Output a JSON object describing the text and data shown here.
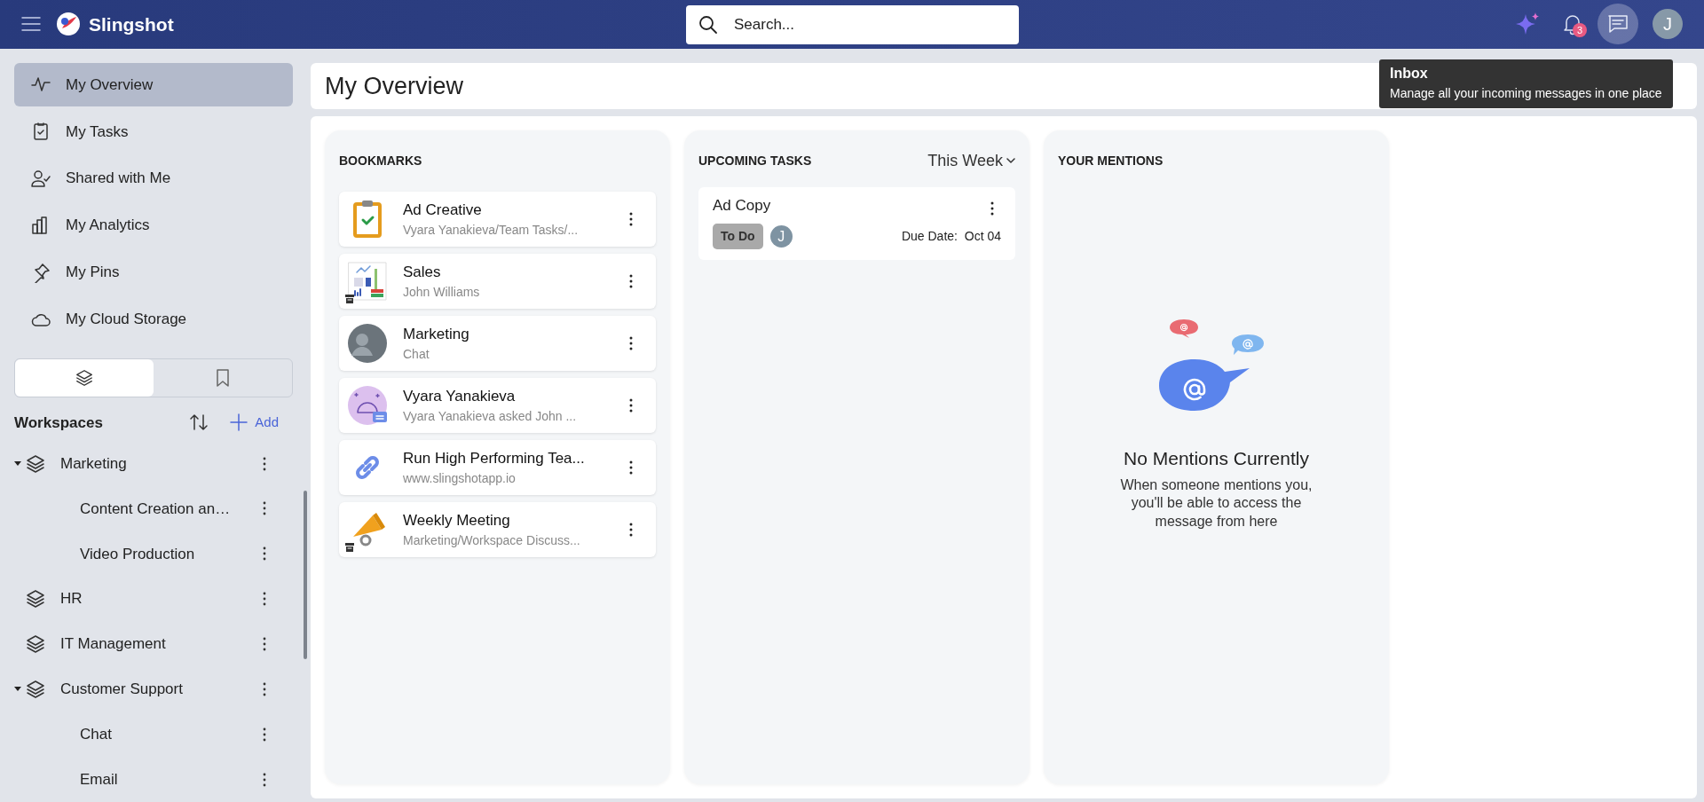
{
  "header": {
    "app_name": "Slingshot",
    "search": {
      "placeholder": "Search..."
    },
    "notification_count": "3",
    "inbox_hovered": true,
    "avatar_letter": "J"
  },
  "tooltip": {
    "title": "Inbox",
    "text": "Manage all your incoming messages in one place"
  },
  "sidebar": {
    "items": [
      {
        "label": "My Overview",
        "kind": "pulse",
        "selected": true
      },
      {
        "label": "My Tasks",
        "kind": "tasks",
        "selected": false
      },
      {
        "label": "Shared with Me",
        "kind": "shared",
        "selected": false
      },
      {
        "label": "My Analytics",
        "kind": "analytics",
        "selected": false
      },
      {
        "label": "My Pins",
        "kind": "pin",
        "selected": false
      },
      {
        "label": "My Cloud Storage",
        "kind": "cloud",
        "selected": false
      }
    ],
    "tabs": [
      {
        "kind": "layers",
        "selected": true
      },
      {
        "kind": "bookmark",
        "selected": false
      }
    ],
    "workspaces_title": "Workspaces",
    "add_label": "Add",
    "workspaces": [
      {
        "label": "Marketing",
        "expanded": true,
        "children": [
          {
            "label": "Content Creation an…"
          },
          {
            "label": "Video Production"
          }
        ]
      },
      {
        "label": "HR"
      },
      {
        "label": "IT Management"
      },
      {
        "label": "Customer Support",
        "expanded": true,
        "children": [
          {
            "label": "Chat"
          },
          {
            "label": "Email"
          }
        ]
      }
    ]
  },
  "page_title": "My Overview",
  "bookmarks": {
    "title": "BOOKMARKS",
    "items": [
      {
        "title": "Ad Creative",
        "subtitle": "Vyara Yanakieva/Team Tasks/...",
        "kind": "clipboard",
        "archive_badge": false
      },
      {
        "title": "Sales",
        "subtitle": "John Williams",
        "kind": "dashboard",
        "archive_badge": true
      },
      {
        "title": "Marketing",
        "subtitle": "Chat",
        "kind": "avatar",
        "archive_badge": false
      },
      {
        "title": "Vyara Yanakieva",
        "subtitle": "Vyara Yanakieva asked John ...",
        "kind": "assistant",
        "archive_badge": false
      },
      {
        "title": "Run High Performing Tea...",
        "subtitle": "www.slingshotapp.io",
        "kind": "link",
        "archive_badge": false
      },
      {
        "title": "Weekly Meeting",
        "subtitle": "Marketing/Workspace Discuss...",
        "kind": "megaphone",
        "archive_badge": true
      }
    ]
  },
  "upcoming_tasks": {
    "title": "UPCOMING TASKS",
    "filter": "This Week",
    "tasks": [
      {
        "title": "Ad Copy",
        "status": "To Do",
        "assignee": "J",
        "due_label": "Due Date:",
        "due_date": "Oct 04"
      }
    ]
  },
  "mentions": {
    "title": "YOUR MENTIONS",
    "empty_title": "No Mentions Currently",
    "empty_text": "When someone mentions you, you'll be able to access the message from here"
  }
}
